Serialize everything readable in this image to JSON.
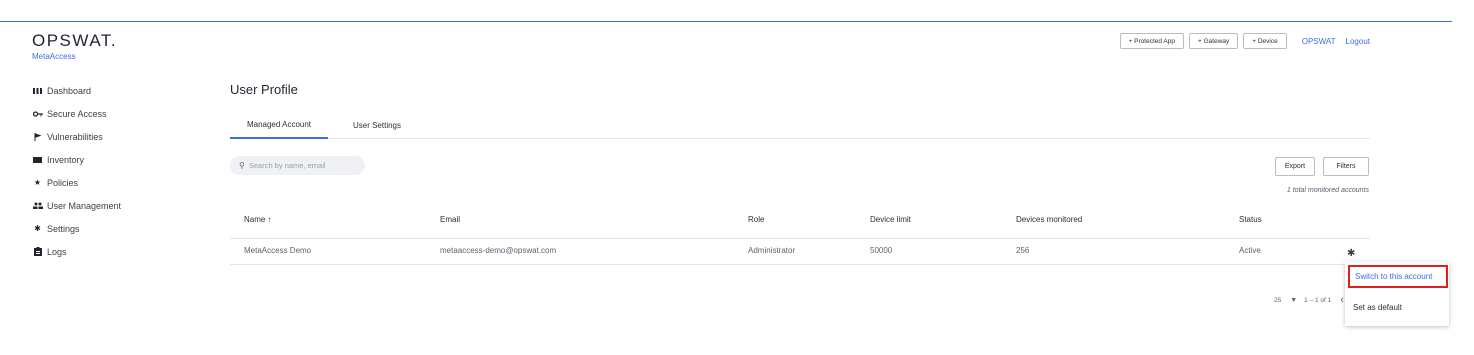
{
  "brand": {
    "name": "OPSWAT.",
    "product": "MetaAccess"
  },
  "colors": {
    "accent": "#3d6ee0",
    "highlight": "#e0201d"
  },
  "sidebar": {
    "items": [
      {
        "label": "Dashboard",
        "icon": "dashboard-icon"
      },
      {
        "label": "Secure Access",
        "icon": "key-icon"
      },
      {
        "label": "Vulnerabilities",
        "icon": "flag-icon"
      },
      {
        "label": "Inventory",
        "icon": "inventory-icon"
      },
      {
        "label": "Policies",
        "icon": "star-icon"
      },
      {
        "label": "User Management",
        "icon": "users-icon"
      },
      {
        "label": "Settings",
        "icon": "gear-icon"
      },
      {
        "label": "Logs",
        "icon": "clipboard-icon"
      }
    ]
  },
  "header": {
    "buttons": [
      "+ Protected App",
      "+ Gateway",
      "+ Device"
    ],
    "account_link": "OPSWAT",
    "logout": "Logout"
  },
  "main": {
    "title": "User Profile",
    "tabs": [
      {
        "label": "Managed Account",
        "active": true
      },
      {
        "label": "User Settings",
        "active": false
      }
    ],
    "search_placeholder": "Search by name, email",
    "export": "Export",
    "filters": "Filters",
    "total": "1 total monitored accounts"
  },
  "table": {
    "headers": [
      "Name ↑",
      "Email",
      "Role",
      "Device limit",
      "Devices monitored",
      "Status"
    ],
    "rows": [
      [
        "MetaAccess Demo",
        "metaaccess-demo@opswat.com",
        "Administrator",
        "50000",
        "256",
        "Active"
      ]
    ]
  },
  "pagination": {
    "page_size": "25",
    "range": "1 – 1 of 1"
  },
  "menu": {
    "items": [
      "Switch to this account",
      "Set as default"
    ]
  }
}
